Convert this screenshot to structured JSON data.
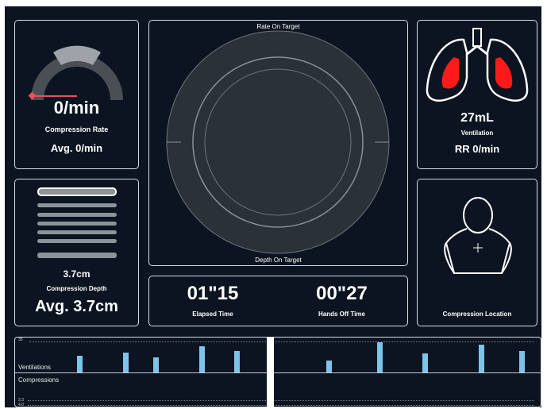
{
  "compression_rate": {
    "value": "0/min",
    "label": "Compression Rate",
    "average": "Avg. 0/min"
  },
  "target": {
    "top_label": "Rate On Target",
    "bottom_label": "Depth On Target"
  },
  "ventilation": {
    "value": "27mL",
    "label": "Ventilation",
    "rr": "RR 0/min"
  },
  "compression_depth": {
    "value": "3.7cm",
    "label": "Compression Depth",
    "average": "Avg. 3.7cm"
  },
  "timers": {
    "elapsed_value": "01\"15",
    "elapsed_label": "Elapsed Time",
    "hands_off_value": "00\"27",
    "hands_off_label": "Hands Off Time"
  },
  "compression_location": {
    "label": "Compression Location"
  },
  "timeline": {
    "ventilations_label": "Ventilations",
    "compressions_label": "Compressions",
    "vent_axis_label": "35",
    "comp_axis_labels": [
      "3.3",
      "4.0"
    ],
    "ventilation_bars": [
      {
        "x": 0.1,
        "level": 0.55
      },
      {
        "x": 0.19,
        "level": 0.67
      },
      {
        "x": 0.25,
        "level": 0.5
      },
      {
        "x": 0.34,
        "level": 0.88
      },
      {
        "x": 0.41,
        "level": 0.72
      },
      {
        "x": 0.59,
        "level": 0.4
      },
      {
        "x": 0.69,
        "level": 1.0
      },
      {
        "x": 0.78,
        "level": 0.62
      },
      {
        "x": 0.89,
        "level": 0.93
      },
      {
        "x": 0.97,
        "level": 0.72
      }
    ]
  },
  "colors": {
    "background": "#0b1420",
    "panel_border": "#d8dde3",
    "lung_fill": "#ff1a1a",
    "ventilation_bar": "#7ec3ea",
    "rate_indicator": "#e8505b"
  },
  "icons": [
    "gauge-icon",
    "lungs-icon",
    "torso-icon",
    "depth-bars-icon"
  ]
}
